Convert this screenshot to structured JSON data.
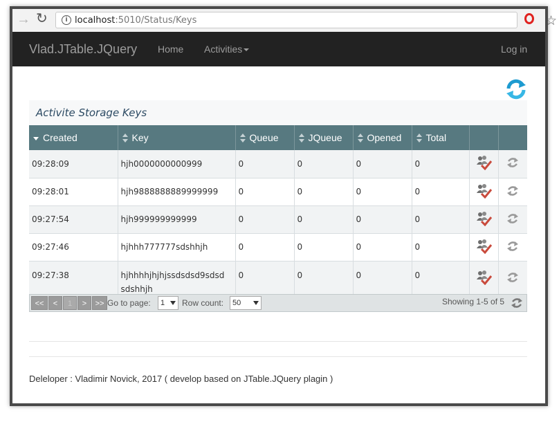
{
  "browser": {
    "url_host": "localhost",
    "url_path": ":5010/Status/Keys"
  },
  "navbar": {
    "brand": "Vlad.JTable.JQuery",
    "home": "Home",
    "activities": "Activities",
    "login": "Log in"
  },
  "page": {
    "title": "Activite Storage Keys"
  },
  "table": {
    "columns": [
      "Created",
      "Key",
      "Queue",
      "JQueue",
      "Opened",
      "Total"
    ],
    "rows": [
      {
        "created": "09:28:09",
        "key": "hjh0000000000999",
        "queue": "0",
        "jqueue": "0",
        "opened": "0",
        "total": "0"
      },
      {
        "created": "09:28:01",
        "key": "hjh9888888889999999",
        "queue": "0",
        "jqueue": "0",
        "opened": "0",
        "total": "0"
      },
      {
        "created": "09:27:54",
        "key": "hjh999999999999",
        "queue": "0",
        "jqueue": "0",
        "opened": "0",
        "total": "0"
      },
      {
        "created": "09:27:46",
        "key": "hjhhh777777sdshhjh",
        "queue": "0",
        "jqueue": "0",
        "opened": "0",
        "total": "0"
      },
      {
        "created": "09:27:38",
        "key": "hjhhhhjhjhjssdsdsd9sdsdsdshhjh",
        "key_line1": "hjhhhhjhjhjssdsdsd9sdsd",
        "key_line2": "sdshhjh",
        "queue": "0",
        "jqueue": "0",
        "opened": "0",
        "total": "0"
      }
    ]
  },
  "pager": {
    "first": "<<",
    "prev": "<",
    "page": "1",
    "next": ">",
    "last": ">>",
    "goto_label": "Go to page:",
    "goto_value": "1",
    "rowcount_label": "Row count:",
    "rowcount_value": "50",
    "showing": "Showing 1-5 of 5"
  },
  "footer": {
    "text": "Deleloper : Vladimir Novick, 2017 ( develop based on JTable.JQuery plagin )"
  },
  "colors": {
    "navbar": "#222222",
    "header": "#577980",
    "title": "#2c4a63",
    "icon_red": "#c94a3c",
    "icon_gray": "#8a8a8a"
  }
}
